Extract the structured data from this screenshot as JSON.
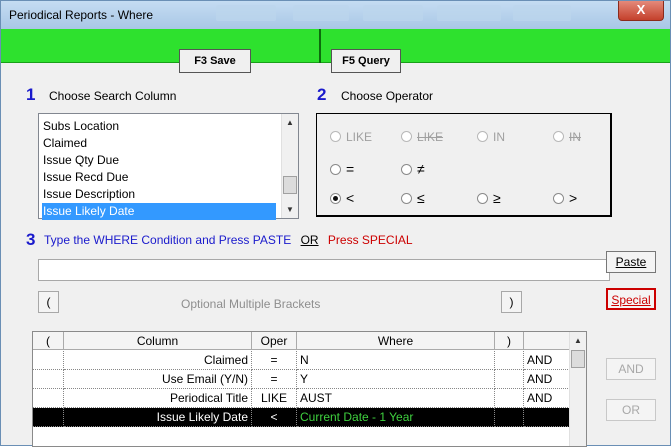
{
  "window": {
    "title": "Periodical Reports - Where",
    "close_label": "X"
  },
  "toolbar": {
    "save_label": "F3 Save",
    "query_label": "F5 Query"
  },
  "section1": {
    "number": "1",
    "title": "Choose Search Column"
  },
  "columns_list": {
    "items": [
      "Subs Location",
      "Claimed",
      "Issue Qty Due",
      "Issue Recd Due",
      "Issue Description",
      "Issue Likely Date"
    ],
    "selected": "Issue Likely Date"
  },
  "section2": {
    "number": "2",
    "title": "Choose Operator"
  },
  "operators": {
    "like": "LIKE",
    "not_like": "LIKE",
    "in": "IN",
    "not_in": "IN",
    "eq": "=",
    "ne": "≠",
    "lt": "<",
    "le": "≤",
    "ge": "≥",
    "gt": ">",
    "selected": "<"
  },
  "section3": {
    "number": "3",
    "text": "Type the WHERE Condition and Press PASTE",
    "or_label": "OR",
    "special_text": "Press SPECIAL"
  },
  "condition_input": {
    "value": ""
  },
  "buttons": {
    "paste": "Paste",
    "special": "Special",
    "and": "AND",
    "or": "OR"
  },
  "brackets": {
    "open": "(",
    "close": ")",
    "label": "Optional Multiple Brackets"
  },
  "grid": {
    "headers": [
      "(",
      "Column",
      "Oper",
      "Where",
      ")",
      ""
    ],
    "rows": [
      {
        "open": "",
        "column": "Claimed",
        "oper": "=",
        "where": "N",
        "close": "",
        "join": "AND"
      },
      {
        "open": "",
        "column": "Use Email (Y/N)",
        "oper": "=",
        "where": "Y",
        "close": "",
        "join": "AND"
      },
      {
        "open": "",
        "column": "Periodical Title",
        "oper": "LIKE",
        "where": "AUST",
        "close": "",
        "join": "AND"
      },
      {
        "open": "",
        "column": "Issue Likely Date",
        "oper": "<",
        "where": "Current Date - 1 Year",
        "close": "",
        "join": ""
      }
    ]
  },
  "colors": {
    "toolbar_bg": "#2ee12e",
    "section_number": "#1a1acc",
    "special_red": "#cc0000",
    "selection_blue": "#3399ff"
  }
}
